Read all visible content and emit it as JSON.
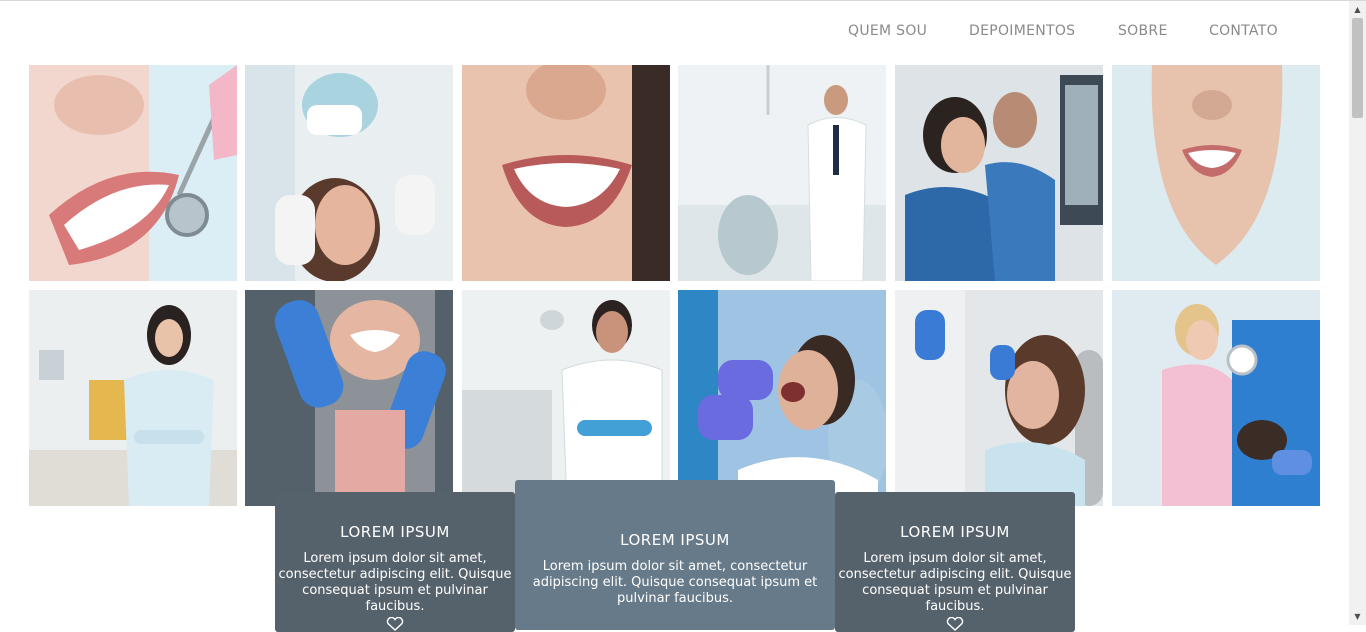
{
  "nav": {
    "items": [
      {
        "label": "QUEM SOU"
      },
      {
        "label": "DEPOIMENTOS"
      },
      {
        "label": "SOBRE"
      },
      {
        "label": "CONTATO"
      }
    ]
  },
  "gallery": {
    "photos": [
      {
        "subject": "smile-with-dental-mirror"
      },
      {
        "subject": "dentist-treating-patient"
      },
      {
        "subject": "smile-closeup"
      },
      {
        "subject": "dentist-standing-in-clinic"
      },
      {
        "subject": "dentists-viewing-xray"
      },
      {
        "subject": "woman-smiling"
      },
      {
        "subject": "female-dentist-portrait"
      },
      {
        "subject": "gloved-hands-treating-smile"
      },
      {
        "subject": "male-dentist-arms-crossed"
      },
      {
        "subject": "man-in-dental-chair"
      },
      {
        "subject": "woman-in-dental-chair"
      },
      {
        "subject": "dentist-with-microscope"
      }
    ]
  },
  "cards": [
    {
      "title": "LOREM IPSUM",
      "text": "Lorem ipsum dolor sit amet, consectetur adipiscing elit. Quisque consequat ipsum et pulvinar faucibus.",
      "icon": "heart-icon"
    },
    {
      "title": "LOREM IPSUM",
      "text": "Lorem ipsum dolor sit amet, consectetur adipiscing elit. Quisque consequat ipsum et pulvinar faucibus."
    },
    {
      "title": "LOREM IPSUM",
      "text": "Lorem ipsum dolor sit amet, consectetur adipiscing elit. Quisque consequat ipsum et pulvinar faucibus.",
      "icon": "heart-icon"
    }
  ],
  "colors": {
    "nav_text": "#8a8a8a",
    "card_dark": "#56626b",
    "card_light": "#667a89"
  }
}
